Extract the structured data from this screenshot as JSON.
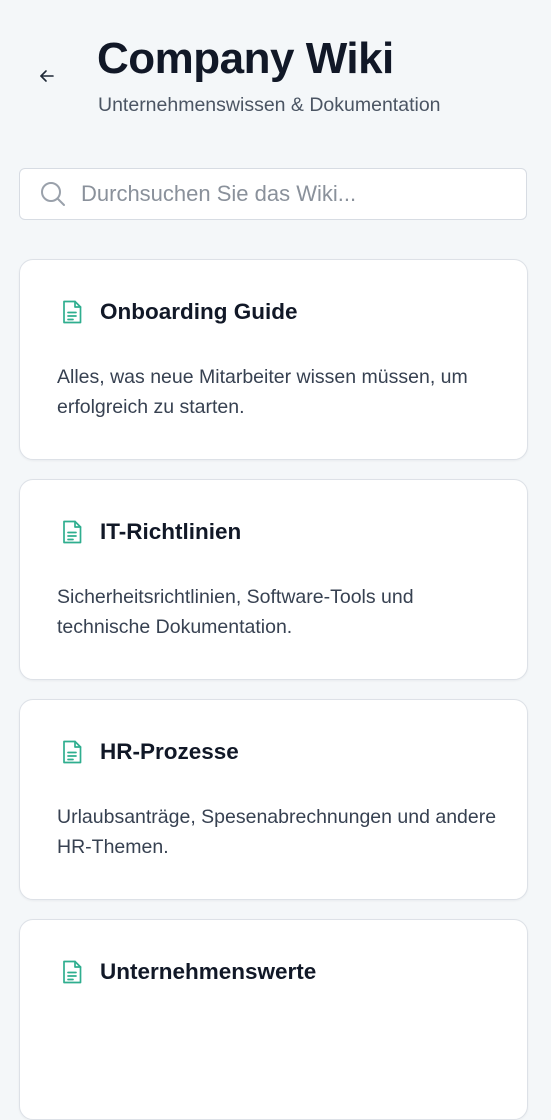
{
  "header": {
    "back_icon": "arrow-left-icon",
    "title": "Company Wiki",
    "subtitle": "Unternehmenswissen & Dokumentation"
  },
  "search": {
    "icon": "search-icon",
    "placeholder": "Durchsuchen Sie das Wiki...",
    "value": ""
  },
  "colors": {
    "accent": "#2fae8f",
    "background": "#f4f7f9",
    "card": "#ffffff",
    "title_text": "#111827",
    "body_text": "#374151"
  },
  "cards": [
    {
      "icon": "document-icon",
      "title": "Onboarding Guide",
      "description": "Alles, was neue Mitarbeiter wissen müssen, um erfolgreich zu starten."
    },
    {
      "icon": "document-icon",
      "title": "IT-Richtlinien",
      "description": "Sicherheitsrichtlinien, Software-Tools und technische Dokumentation."
    },
    {
      "icon": "document-icon",
      "title": "HR-Prozesse",
      "description": "Urlaubsanträge, Spesenabrechnungen und andere HR-Themen."
    },
    {
      "icon": "document-icon",
      "title": "Unternehmenswerte",
      "description": ""
    }
  ]
}
